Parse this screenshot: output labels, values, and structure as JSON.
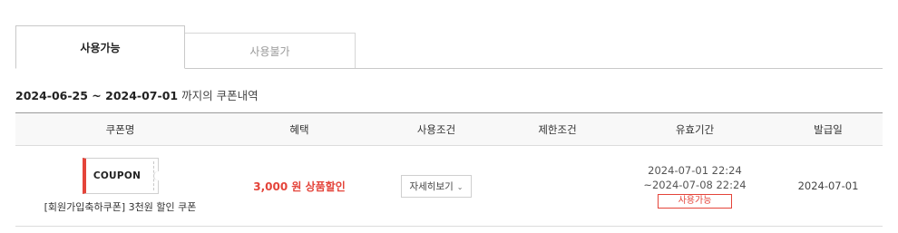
{
  "tabs": [
    {
      "label": "사용가능",
      "active": true
    },
    {
      "label": "사용불가",
      "active": false
    }
  ],
  "period": {
    "dates": "2024-06-25 ~ 2024-07-01",
    "suffix": "까지의 쿠폰내역"
  },
  "table": {
    "headers": [
      "쿠폰명",
      "혜택",
      "사용조건",
      "제한조건",
      "유효기간",
      "발급일"
    ],
    "rows": [
      {
        "coupon_badge": "COUPON",
        "name": "[회원가입축하쿠폰] 3천원 할인 쿠폰",
        "benefit": "3,000 원 상품할인",
        "detail_button": "자세히보기",
        "restriction": "",
        "validity_start": "2024-07-01 22:24",
        "validity_end": "~2024-07-08 22:24",
        "status": "사용가능",
        "issued": "2024-07-01"
      }
    ]
  },
  "colors": {
    "accent": "#e4443a",
    "border": "#c9c9c9"
  }
}
